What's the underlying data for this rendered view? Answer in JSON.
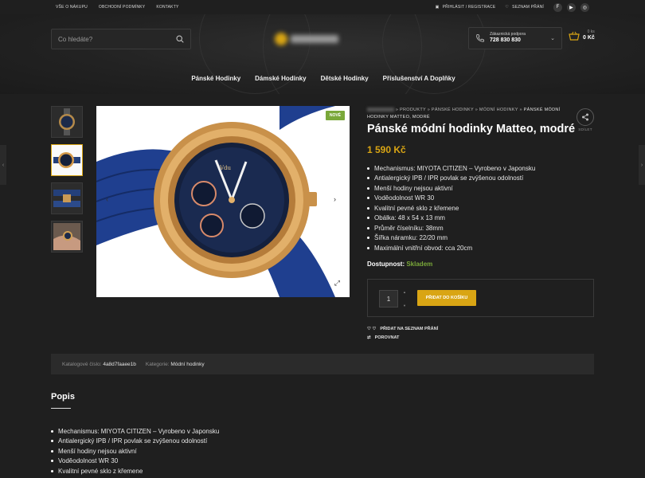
{
  "topbar": {
    "links": [
      "VŠE O NÁKUPU",
      "OBCHODNÍ PODMÍNKY",
      "KONTAKTY"
    ],
    "login": "PŘIHLÁSIT / REGISTRACE",
    "wishlist": "SEZNAM PŘÁNÍ",
    "social": [
      "f",
      "▶",
      "◎"
    ]
  },
  "header": {
    "search_placeholder": "Co hledáte?",
    "support_label": "Zákaznická podpora",
    "support_phone": "728 830 830",
    "cart_count": "0 ks",
    "cart_total": "0 Kč"
  },
  "nav": [
    "Pánské Hodinky",
    "Dámské Hodinky",
    "Dětské Hodinky",
    "Příslušenství A Doplňky"
  ],
  "product": {
    "badge": "NOVÉ",
    "breadcrumb": [
      "PRODUKTY",
      "PÁNSKÉ HODINKY",
      "MÓDNÍ HODINKY"
    ],
    "breadcrumb_current": "PÁNSKÉ MÓDNÍ HODINKY MATTEO, MODRÉ",
    "share_label": "SDÍLET",
    "title": "Pánské módní hodinky Matteo, modré",
    "price": "1 590 Kč",
    "features": [
      "Mechanismus: MIYOTA CITIZEN – Vyrobeno v Japonsku",
      "Antialergický IPB / IPR povlak se zvýšenou odolností",
      "Menší hodiny nejsou aktivní",
      "Voděodolnost WR 30",
      "Kvalitní pevné sklo z křemene",
      "Obálka: 48 x 54 x 13 mm",
      "Průměr číselníku: 38mm",
      "Šířka náramku: 22/20 mm",
      "Maximální vnitřní obvod: cca 20cm"
    ],
    "availability_label": "Dostupnost:",
    "availability_value": "Skladem",
    "quantity": "1",
    "add_to_cart": "PŘIDAT DO KOŠÍKU",
    "add_wishlist": "PŘIDAT NA SEZNAM PŘÁNÍ",
    "compare": "POROVNAT"
  },
  "meta": {
    "catalog_label": "Katalogové číslo:",
    "catalog_value": "4a8d7faaee1b",
    "category_label": "Kategorie:",
    "category_value": "Módní hodinky"
  },
  "description": {
    "heading": "Popis",
    "items": [
      "Mechanismus: MIYOTA CITIZEN – Vyrobeno v Japonsku",
      "Antialergický IPB / IPR povlak se zvýšenou odolností",
      "Menší hodiny nejsou aktivní",
      "Voděodolnost WR 30",
      "Kvalitní pevné sklo z křemene"
    ]
  },
  "colors": {
    "accent": "#d9a514",
    "success": "#7aa83a",
    "background": "#1f1f1f"
  }
}
